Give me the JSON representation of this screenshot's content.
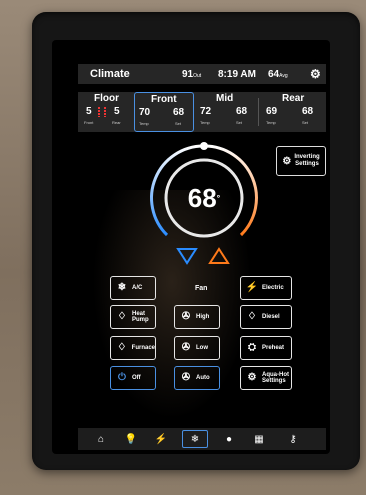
{
  "header": {
    "title": "Climate",
    "outside_temp": "91",
    "outside_label": "Out",
    "time": "8:19 AM",
    "inside_temp": "64",
    "inside_label": "Avg"
  },
  "zones": {
    "floor": {
      "name": "Floor",
      "v1": "5",
      "v2": "5",
      "l1": "Front",
      "l2": "Rear"
    },
    "front": {
      "name": "Front",
      "v1": "70",
      "v2": "68",
      "l1": "Temp",
      "l2": "Set"
    },
    "mid": {
      "name": "Mid",
      "v1": "72",
      "v2": "68",
      "l1": "Temp",
      "l2": "Set"
    },
    "rear": {
      "name": "Rear",
      "v1": "69",
      "v2": "68",
      "l1": "Temp",
      "l2": "Set"
    }
  },
  "setpoint": "68",
  "settings_button": {
    "line1": "Inverting",
    "line2": "Settings"
  },
  "fan_label": "Fan",
  "buttons": {
    "ac": "A/C",
    "electric": "Electric",
    "heat_pump_1": "Heat",
    "heat_pump_2": "Pump",
    "fan_high": "High",
    "diesel": "Diesel",
    "furnace": "Furnace",
    "fan_low": "Low",
    "preheat": "Preheat",
    "off": "Off",
    "fan_auto": "Auto",
    "aquahot_1": "Aqua-Hot",
    "aquahot_2": "Settings"
  },
  "colors": {
    "accent_blue": "#4a90e2",
    "heat_orange": "#ff7a1a",
    "cool_blue": "#2a8cff"
  },
  "icons": {
    "nav": [
      "home-icon",
      "bulb-icon",
      "lightning-icon",
      "snowflake-icon",
      "power-icon",
      "grid-icon",
      "key-icon"
    ]
  }
}
